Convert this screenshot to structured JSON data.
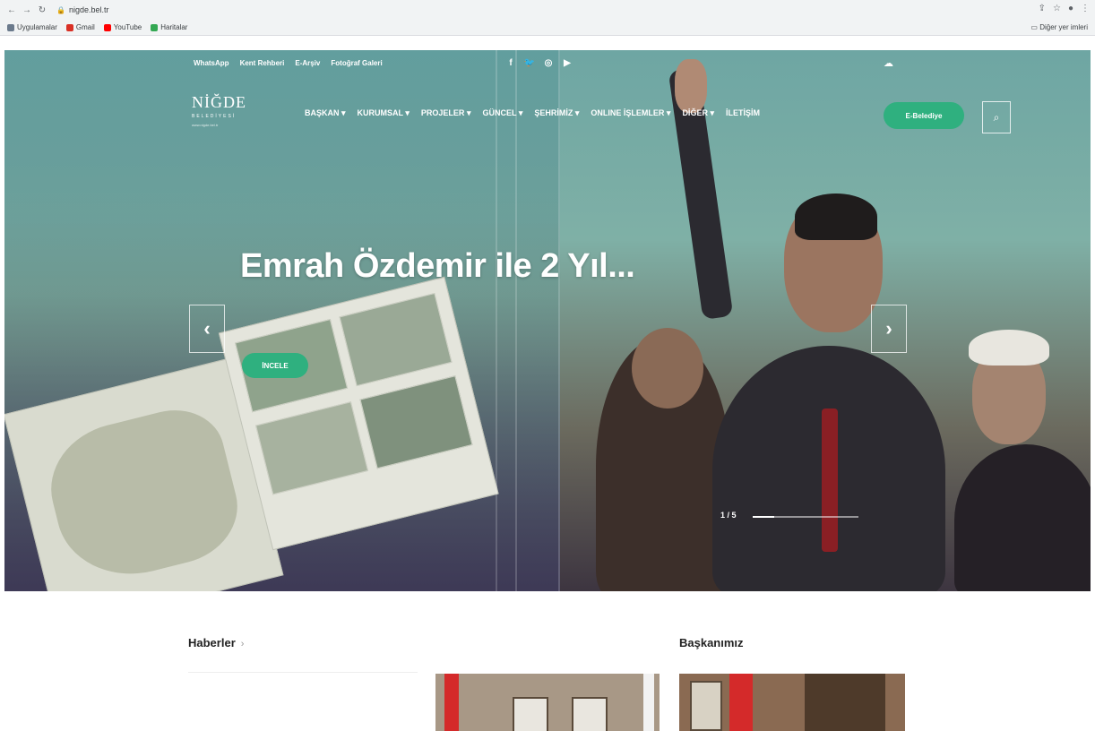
{
  "browser": {
    "url": "nigde.bel.tr",
    "bookmarks": [
      {
        "label": "Uygulamalar",
        "color": "#6b7a8c"
      },
      {
        "label": "Gmail",
        "color": "#d93025"
      },
      {
        "label": "YouTube",
        "color": "#ff0000"
      },
      {
        "label": "Haritalar",
        "color": "#34a853"
      }
    ],
    "other_bookmarks": "Diğer yer imleri"
  },
  "hero": {
    "topbar": [
      "WhatsApp",
      "Kent Rehberi",
      "E-Arşiv",
      "Fotoğraf Galeri"
    ],
    "social": [
      "facebook-icon",
      "twitter-icon",
      "instagram-icon",
      "youtube-icon"
    ],
    "logo": {
      "title": "NİĞDE",
      "subtitle": "BELEDİYESİ",
      "tagline": "www.nigde.bel.tr"
    },
    "nav": [
      "BAŞKAN",
      "KURUMSAL",
      "PROJELER",
      "GÜNCEL",
      "ŞEHRİMİZ",
      "ONLINE İŞLEMLER",
      "İLETİŞİM",
      "DİĞER"
    ],
    "ebelediye_label": "E-Belediye",
    "slide_title": "Emrah Özdemir ile 2 Yıl...",
    "incele_label": "İNCELE",
    "slide_counter": "1 / 5",
    "progress_fraction": 0.2,
    "accent": "#2fb07f"
  },
  "sections": {
    "news_title": "Haberler",
    "president_title": "Başkanımız"
  }
}
